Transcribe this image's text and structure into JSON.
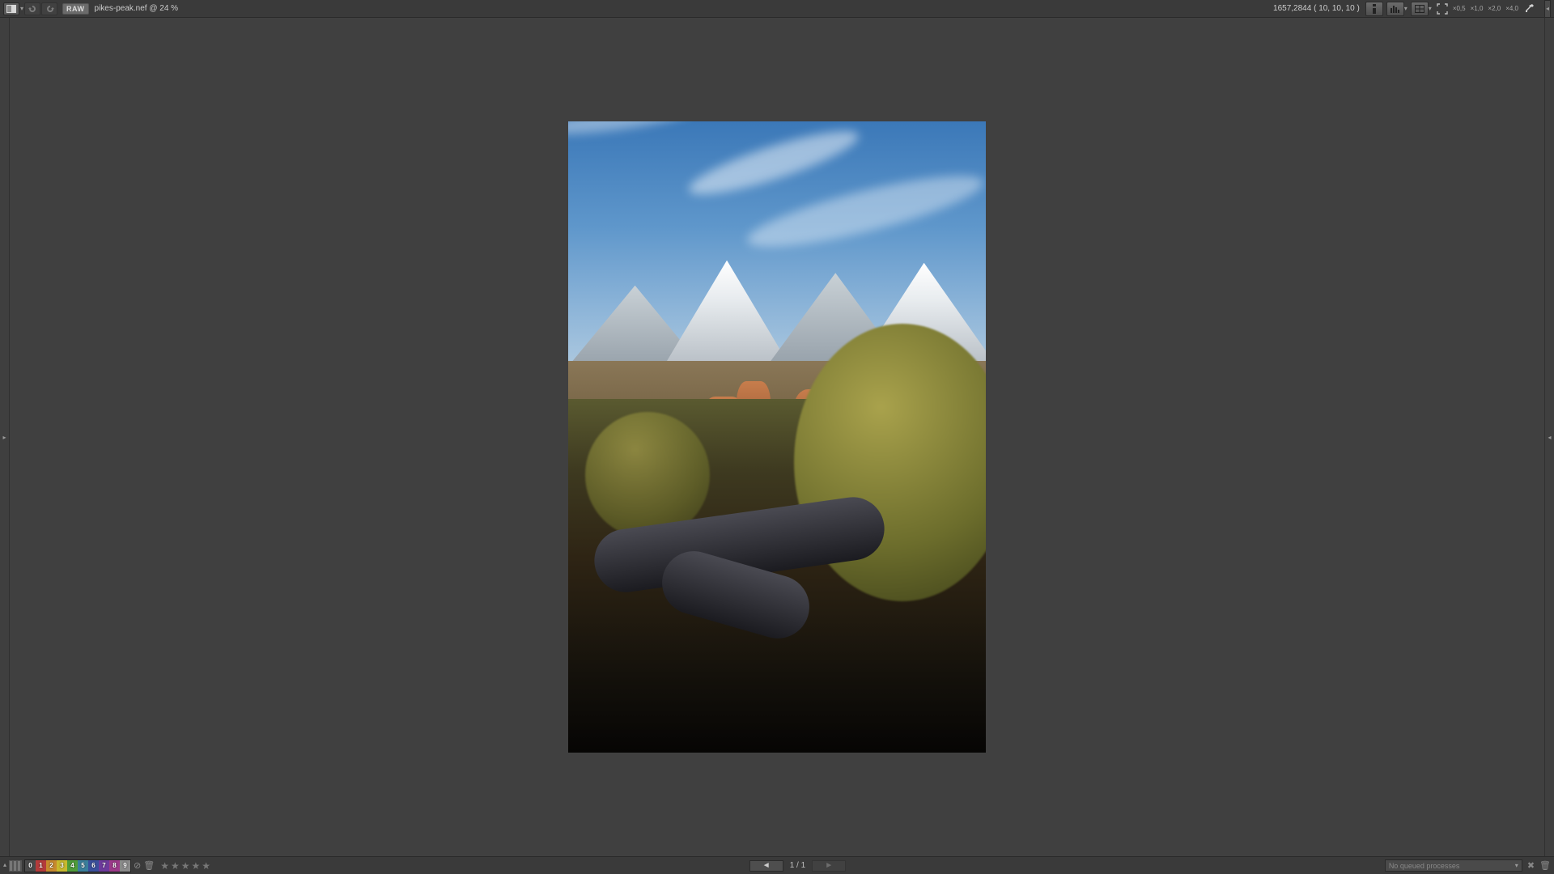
{
  "header": {
    "raw_badge": "RAW",
    "file_label": "pikes-peak.nef @ 24 %",
    "cursor_info": "1657,2844 ( 10, 10, 10 )",
    "zoom": [
      "×0,5",
      "×1,0",
      "×2,0",
      "×4,0"
    ]
  },
  "nav": {
    "page_label": "1 / 1"
  },
  "queue": {
    "selected": "No queued processes"
  },
  "swatches": [
    {
      "n": "0",
      "color": "#4a4a4a"
    },
    {
      "n": "1",
      "color": "#b43b3b"
    },
    {
      "n": "2",
      "color": "#c78a2e"
    },
    {
      "n": "3",
      "color": "#c7b92e"
    },
    {
      "n": "4",
      "color": "#4f9c3a"
    },
    {
      "n": "5",
      "color": "#3a7f9c"
    },
    {
      "n": "6",
      "color": "#3a4f9c"
    },
    {
      "n": "7",
      "color": "#6d3a9c"
    },
    {
      "n": "8",
      "color": "#9c3a8a"
    },
    {
      "n": "9",
      "color": "#8a8a8a"
    }
  ]
}
